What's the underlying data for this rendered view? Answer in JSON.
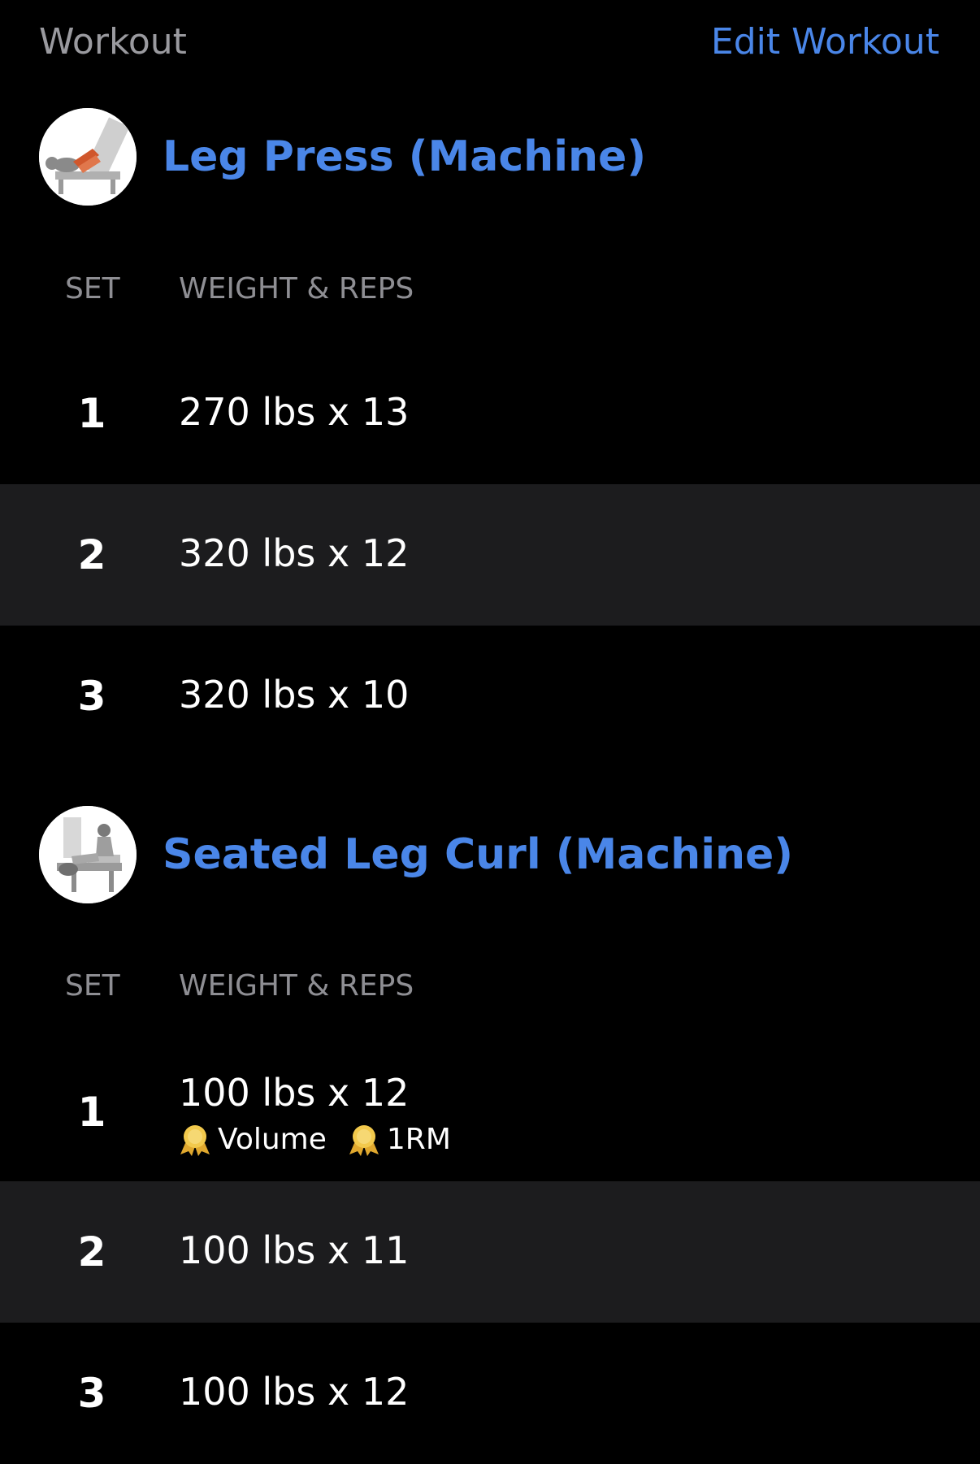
{
  "header": {
    "title": "Workout",
    "edit_label": "Edit Workout"
  },
  "colors": {
    "accent": "#4a86e8",
    "muted": "#8e8e93",
    "row_alt": "#1c1c1e",
    "medal": "#f2c94c"
  },
  "exercises": [
    {
      "name": "Leg Press (Machine)",
      "thumbnail_icon": "leg-press-illustration",
      "col_set": "SET",
      "col_weight_reps": "WEIGHT & REPS",
      "sets": [
        {
          "num": "1",
          "value": "270 lbs x 13"
        },
        {
          "num": "2",
          "value": "320 lbs x 12"
        },
        {
          "num": "3",
          "value": "320 lbs x 10"
        }
      ]
    },
    {
      "name": "Seated Leg Curl (Machine)",
      "thumbnail_icon": "seated-leg-curl-illustration",
      "col_set": "SET",
      "col_weight_reps": "WEIGHT & REPS",
      "sets": [
        {
          "num": "1",
          "value": "100 lbs x 12",
          "badges": [
            "Volume",
            "1RM"
          ]
        },
        {
          "num": "2",
          "value": "100 lbs x 11"
        },
        {
          "num": "3",
          "value": "100 lbs x 12"
        }
      ]
    }
  ]
}
